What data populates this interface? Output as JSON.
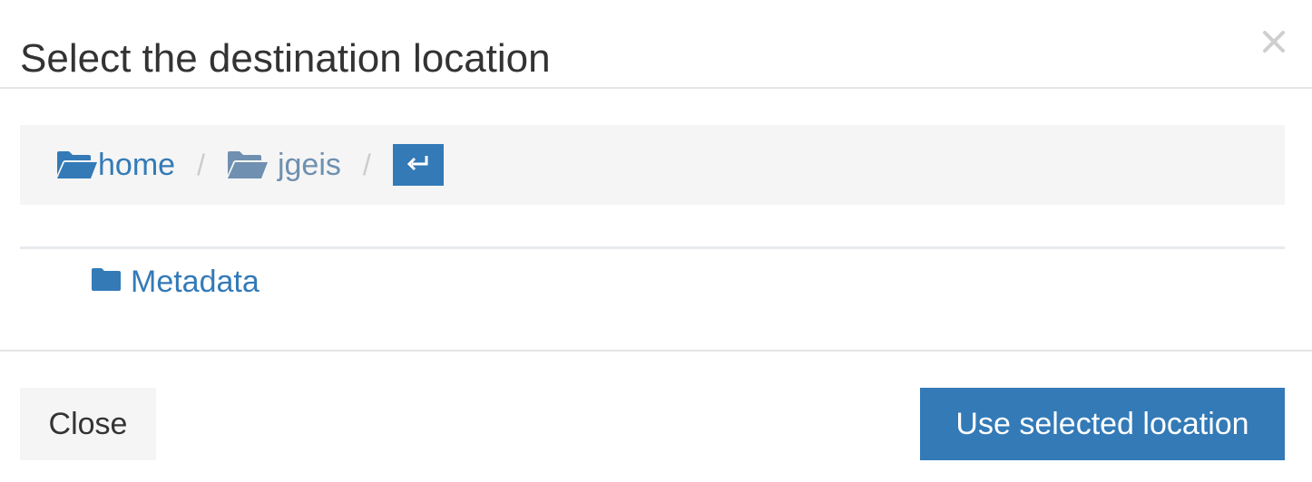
{
  "dialog": {
    "title": "Select the destination location",
    "close_icon": "close-icon"
  },
  "breadcrumb": {
    "items": [
      {
        "label": "home",
        "icon": "folder-open-icon"
      },
      {
        "label": "jgeis",
        "icon": "folder-open-icon"
      }
    ],
    "separator": "/",
    "enter_icon": "enter-icon"
  },
  "folders": [
    {
      "label": "Metadata",
      "icon": "folder-icon"
    }
  ],
  "footer": {
    "close_label": "Close",
    "use_label": "Use selected location"
  },
  "colors": {
    "primary": "#337ab7",
    "muted_link": "#6f90b0",
    "breadcrumb_bg": "#f5f5f5",
    "title_text": "#333333"
  }
}
